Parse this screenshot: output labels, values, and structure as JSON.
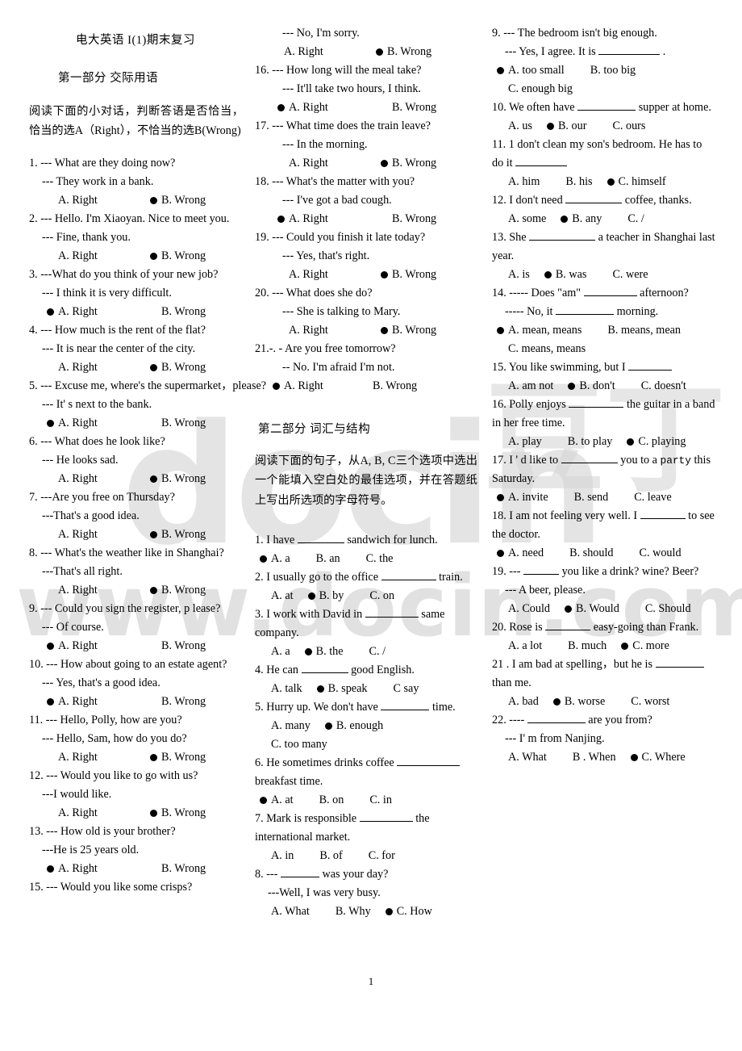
{
  "document": {
    "title": "电大英语 I(1)期末复习",
    "page_number": "1",
    "watermark": {
      "logo_text": "docin",
      "cn_text": "豆丁",
      "url_text": "www.docin.com",
      "color": "#d4d4d4"
    }
  },
  "part1": {
    "heading": "第一部分    交际用语",
    "instruction": "阅读下面的小对话，判断答语是否恰当，恰当的选A（Right），不恰当的选B(Wrong)",
    "option_a_label": "A.",
    "option_b_label": "B.",
    "right_label": "Right",
    "wrong_label": "Wrong",
    "questions": [
      {
        "num": "1.",
        "stem": "--- What are they doing now?",
        "reply": "--- They work in a bank.",
        "answer": "B"
      },
      {
        "num": "2.",
        "stem": "--- Hello. I'm Xiaoyan. Nice to meet you.",
        "reply": "--- Fine, thank you.",
        "answer": "B"
      },
      {
        "num": "3.",
        "stem": "---What do you think of your new job?",
        "reply": "--- I think it is very difficult.",
        "answer": "A"
      },
      {
        "num": "4.",
        "stem": "--- How much is the rent of the flat?",
        "reply": "--- It is near the center of the city.",
        "answer": "B"
      },
      {
        "num": "5.",
        "stem": "--- Excuse me, where's the supermarket，please?",
        "reply": "--- It' s next to the bank.",
        "answer": "A"
      },
      {
        "num": "6.",
        "stem": "--- What does he look like?",
        "reply": "--- He looks sad.",
        "answer": "B"
      },
      {
        "num": "7.",
        "stem": "---Are you free on Thursday?",
        "reply": "---That's a good idea.",
        "answer": "B"
      },
      {
        "num": "8.",
        "stem": "--- What's the weather like in Shanghai?",
        "reply": "---That's all right.",
        "answer": "B"
      },
      {
        "num": "9.",
        "stem": "--- Could you sign the register, p lease?",
        "reply": "--- Of course.",
        "answer": "A"
      },
      {
        "num": "10.",
        "stem": "--- How about going to an estate agent?",
        "reply": "--- Yes, that's a good idea.",
        "answer": "A"
      },
      {
        "num": "11.",
        "stem": "--- Hello, Polly, how are you?",
        "reply": "--- Hello, Sam, how do you do?",
        "answer": "B"
      },
      {
        "num": "12.",
        "stem": "--- Would you like to go with us?",
        "reply": "---I would like.",
        "answer": "B"
      },
      {
        "num": "13.",
        "stem": "--- How old is your brother?",
        "reply": "---He is 25 years old.",
        "answer": "A"
      },
      {
        "num": "15.",
        "stem": "--- Would you like some crisps?",
        "reply": "---  No, I'm sorry.",
        "answer": "B"
      },
      {
        "num": "16.",
        "stem": "--- How long will the meal take?",
        "reply": "--- It'll take two hours, I think.",
        "answer": "A"
      },
      {
        "num": "17.",
        "stem": "--- What time does the train leave?",
        "reply": "--- In the morning.",
        "answer": "B"
      },
      {
        "num": "18.",
        "stem": "--- What's the matter with you?",
        "reply": "--- I've got a bad cough.",
        "answer": "A"
      },
      {
        "num": "19.",
        "stem": "--- Could you finish it late today?",
        "reply": "--- Yes, that's right.",
        "answer": "B"
      },
      {
        "num": "20.",
        "stem": "--- What does she do?",
        "reply": "--- She is talking to Mary.",
        "answer": "B"
      },
      {
        "num": "21.-.",
        "stem": "- Are you free tomorrow?",
        "reply": "-- No. I'm afraid I'm not.",
        "answer": "A"
      }
    ]
  },
  "part2": {
    "heading": "第二部分    词汇与结构",
    "instruction": "阅读下面的句子，从A, B, C三个选项中选出一个能填入空白处的最佳选项，并在答题纸上写出所选项的字母符号。",
    "questions": [
      {
        "num": "1.",
        "stem_pre": "I have",
        "stem_post": "sandwich for lunch.",
        "blank_w": 58,
        "options": [
          {
            "label": "A. a",
            "sel": true
          },
          {
            "label": "B. an",
            "sel": false
          },
          {
            "label": "C. the",
            "sel": false
          }
        ]
      },
      {
        "num": "2.",
        "stem_pre": "I usually go to the office",
        "stem_post": "train.",
        "blank_w": 68,
        "options": [
          {
            "label": "A. at",
            "sel": false
          },
          {
            "label": "B. by",
            "sel": true
          },
          {
            "label": "C. on",
            "sel": false
          }
        ]
      },
      {
        "num": "3.",
        "stem_pre": "I work with David in",
        "stem_post": "same company.",
        "blank_w": 66,
        "options": [
          {
            "label": "A. a",
            "sel": false
          },
          {
            "label": "B. the",
            "sel": true
          },
          {
            "label": "C. /",
            "sel": false
          }
        ]
      },
      {
        "num": "4.",
        "stem_pre": "He can",
        "stem_post": "good English.",
        "blank_w": 58,
        "options": [
          {
            "label": "A. talk",
            "sel": false
          },
          {
            "label": "B. speak",
            "sel": true
          },
          {
            "label": "C say",
            "sel": false
          }
        ]
      },
      {
        "num": "5.",
        "stem_pre": "Hurry up. We don't have",
        "stem_post": "time.",
        "blank_w": 60,
        "options": [
          {
            "label": "A. many",
            "sel": false
          },
          {
            "label": "B. enough",
            "sel": true
          },
          {
            "label": "C. too many",
            "sel": false
          }
        ]
      },
      {
        "num": "6.",
        "stem_pre": "He sometimes drinks coffee",
        "stem_post": "breakfast time.",
        "blank_w": 78,
        "options": [
          {
            "label": "A. at",
            "sel": true
          },
          {
            "label": "B. on",
            "sel": false
          },
          {
            "label": "C. in",
            "sel": false
          }
        ]
      },
      {
        "num": "7.",
        "stem_pre": "Mark is responsible",
        "stem_post": "the international market.",
        "blank_w": 66,
        "options": [
          {
            "label": "A. in",
            "sel": false
          },
          {
            "label": "B. of",
            "sel": false
          },
          {
            "label": "C. for",
            "sel": false
          }
        ]
      },
      {
        "num": "8.",
        "stem_pre": "---",
        "stem_post": "was your day?",
        "blank_w": 48,
        "reply": "---Well, I was very busy.",
        "options": [
          {
            "label": "A. What",
            "sel": false
          },
          {
            "label": "B. Why",
            "sel": false
          },
          {
            "label": "C. How",
            "sel": true
          }
        ]
      },
      {
        "num": "9.",
        "stem": "--- The bedroom isn't big enough.",
        "reply_pre": "--- Yes, I agree. It is",
        "reply_post": ".",
        "blank_w": 76,
        "options": [
          {
            "label": "A. too   small",
            "sel": true
          },
          {
            "label": "B. too big",
            "sel": false
          },
          {
            "label": "C. enough big",
            "sel": false
          }
        ]
      },
      {
        "num": "10.",
        "stem_pre": "We often have",
        "stem_post": "supper at home.",
        "blank_w": 72,
        "options": [
          {
            "label": "A. us",
            "sel": false
          },
          {
            "label": "B. our",
            "sel": true
          },
          {
            "label": "C. ours",
            "sel": false
          }
        ]
      },
      {
        "num": "11.",
        "stem_pre": "1 don't clean my son's bedroom. He has to do it",
        "stem_post": "",
        "blank_w": 64,
        "options": [
          {
            "label": "A. him",
            "sel": false
          },
          {
            "label": "B. his",
            "sel": false
          },
          {
            "label": "C. himself",
            "sel": true
          }
        ]
      },
      {
        "num": "12.",
        "stem_pre": "I don't need",
        "stem_post": "coffee, thanks.",
        "blank_w": 70,
        "options": [
          {
            "label": "A. some",
            "sel": false
          },
          {
            "label": "B. any",
            "sel": true
          },
          {
            "label": "C. /",
            "sel": false
          }
        ]
      },
      {
        "num": "13.",
        "stem_pre": "She",
        "stem_post": "a teacher in Shanghai last year.",
        "blank_w": 82,
        "options": [
          {
            "label": "A. is",
            "sel": false
          },
          {
            "label": "B. was",
            "sel": true
          },
          {
            "label": "C. were",
            "sel": false
          }
        ]
      },
      {
        "num": "14.",
        "stem_pre": "----- Does \"am\"",
        "stem_post": "afternoon?",
        "blank_w": 66,
        "reply_pre": "----- No, it",
        "reply_post": "morning.",
        "reply_blank_w": 72,
        "options": [
          {
            "label": "A. mean, means",
            "sel": true
          },
          {
            "label": "B. means, mean",
            "sel": false
          },
          {
            "label": "C. means, means",
            "sel": false
          }
        ]
      },
      {
        "num": "15.",
        "stem_pre": "You like swimming, but I",
        "stem_post": "",
        "blank_w": 54,
        "options": [
          {
            "label": "A. am not",
            "sel": false
          },
          {
            "label": "B. don't",
            "sel": true
          },
          {
            "label": "C. doesn't",
            "sel": false
          }
        ]
      },
      {
        "num": "16.",
        "stem_pre": "Polly enjoys",
        "stem_post": "the guitar in a band in her free time.",
        "blank_w": 68,
        "options": [
          {
            "label": "A. play",
            "sel": false
          },
          {
            "label": "B. to play",
            "sel": false
          },
          {
            "label": "C. playing",
            "sel": true
          }
        ]
      },
      {
        "num": "17.",
        "stem_pre": "I ' d like to",
        "stem_post": "you to a ",
        "stem_mono": "party",
        "stem_tail": " this Saturday.",
        "blank_w": 70,
        "options": [
          {
            "label": "A. invite",
            "sel": true
          },
          {
            "label": "B. send",
            "sel": false
          },
          {
            "label": "C. leave",
            "sel": false
          }
        ]
      },
      {
        "num": "18.",
        "stem_pre": "I am not feeling very well. I",
        "stem_post": "to see the doctor.",
        "blank_w": 56,
        "options": [
          {
            "label": "A. need",
            "sel": true
          },
          {
            "label": "B. should",
            "sel": false
          },
          {
            "label": "C. would",
            "sel": false
          }
        ]
      },
      {
        "num": "19.",
        "stem_pre": "---",
        "stem_post": "you like a drink? wine? Beer?",
        "blank_w": 44,
        "reply": "--- A beer, please.",
        "options": [
          {
            "label": "A. Could",
            "sel": false
          },
          {
            "label": "B. Would",
            "sel": true
          },
          {
            "label": "C. Should",
            "sel": false
          }
        ]
      },
      {
        "num": "20.",
        "stem_pre": "Rose is",
        "stem_post": "easy-going than Frank.",
        "blank_w": 56,
        "options": [
          {
            "label": "A. a lot",
            "sel": false
          },
          {
            "label": "B. much",
            "sel": false
          },
          {
            "label": "C. more",
            "sel": true
          }
        ]
      },
      {
        "num": "21 .",
        "stem_pre": "I am bad at spelling，but he is",
        "stem_post": "than me.",
        "blank_w": 60,
        "options": [
          {
            "label": "A. bad",
            "sel": false
          },
          {
            "label": "B. worse",
            "sel": true
          },
          {
            "label": "C. worst",
            "sel": false
          }
        ]
      },
      {
        "num": "22.",
        "stem_pre": "----",
        "stem_post": "are you from?",
        "blank_w": 72,
        "reply": "--- I' m from Nanjing.",
        "options": [
          {
            "label": "A. What",
            "sel": false
          },
          {
            "label": "B . When",
            "sel": false
          },
          {
            "label": "C. Where",
            "sel": true
          }
        ]
      }
    ]
  }
}
